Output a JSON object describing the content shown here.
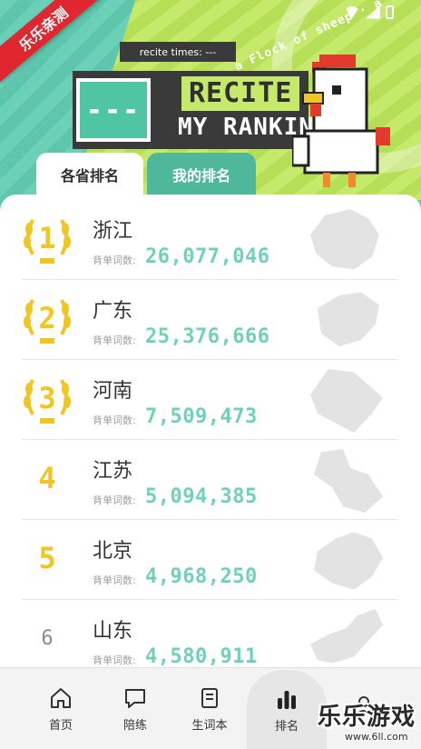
{
  "header": {
    "ribbon_text": "乐乐亲测",
    "ring_text": "a Flock of sheep · a lion",
    "recite_times": "recite times: ---",
    "rank_value": "---",
    "title_line1": "RECITE",
    "title_line2": "MY RANKIN",
    "tabs": [
      {
        "label": "各省排名",
        "active": true
      },
      {
        "label": "我的排名",
        "active": false
      }
    ]
  },
  "rows": [
    {
      "rank": "1",
      "province": "浙江",
      "label": "背单词数:",
      "value": "26,077,046",
      "laurel": true,
      "rank_style": "gold"
    },
    {
      "rank": "2",
      "province": "广东",
      "label": "背单词数:",
      "value": "25,376,666",
      "laurel": true,
      "rank_style": "gold"
    },
    {
      "rank": "3",
      "province": "河南",
      "label": "背单词数:",
      "value": "7,509,473",
      "laurel": true,
      "rank_style": "gold"
    },
    {
      "rank": "4",
      "province": "江苏",
      "label": "背单词数:",
      "value": "5,094,385",
      "laurel": false,
      "rank_style": "gold"
    },
    {
      "rank": "5",
      "province": "北京",
      "label": "背单词数:",
      "value": "4,968,250",
      "laurel": false,
      "rank_style": "gold"
    },
    {
      "rank": "6",
      "province": "山东",
      "label": "背单词数:",
      "value": "4,580,911",
      "laurel": false,
      "rank_style": "grey"
    }
  ],
  "bottom_nav": [
    {
      "label": "首页",
      "icon": "home-icon",
      "active": false
    },
    {
      "label": "陪练",
      "icon": "chat-icon",
      "active": false
    },
    {
      "label": "生词本",
      "icon": "notebook-icon",
      "active": false
    },
    {
      "label": "排名",
      "icon": "bar-chart-icon",
      "active": true
    },
    {
      "label": "",
      "icon": "user-icon",
      "active": false
    }
  ],
  "watermark": {
    "big": "乐乐游戏",
    "small": "www.6ll.com"
  },
  "colors": {
    "accent_teal": "#6fd1b6",
    "gold": "#f3c522",
    "header_green": "#c5e96a",
    "ribbon_red": "#e0262e"
  }
}
